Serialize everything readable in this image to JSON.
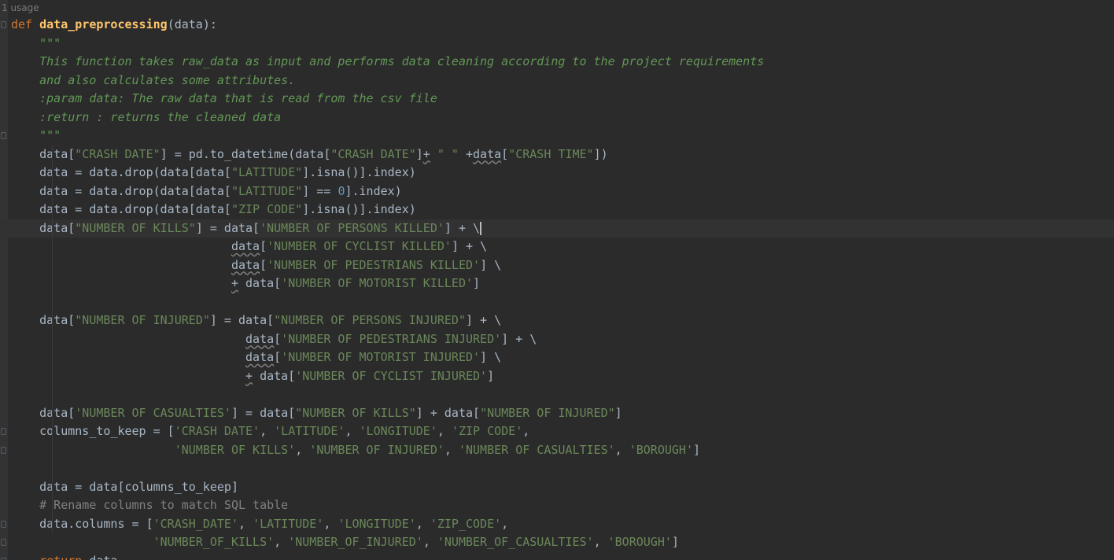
{
  "editor": {
    "usage_hint": "1 usage",
    "caret": {
      "line": 11
    },
    "lines": [
      [
        {
          "t": "def",
          "c": "kw"
        },
        {
          "t": " "
        },
        {
          "t": "data_preprocessing",
          "c": "fn"
        },
        {
          "t": "(data):"
        }
      ],
      [
        {
          "t": "    \"\"\"",
          "c": "doc"
        }
      ],
      [
        {
          "t": "    This function takes raw_data as input and performs data cleaning according to the project requirements",
          "c": "doc"
        }
      ],
      [
        {
          "t": "    and also calculates some attributes.",
          "c": "doc"
        }
      ],
      [
        {
          "t": "    :param data: The raw data that is read from the csv file",
          "c": "doc"
        }
      ],
      [
        {
          "t": "    :return : returns the cleaned data",
          "c": "doc"
        }
      ],
      [
        {
          "t": "    \"\"\"",
          "c": "doc"
        }
      ],
      [
        {
          "t": "    data["
        },
        {
          "t": "\"CRASH DATE\"",
          "c": "str"
        },
        {
          "t": "] = pd.to_datetime(data["
        },
        {
          "t": "\"CRASH DATE\"",
          "c": "str"
        },
        {
          "t": "]"
        },
        {
          "t": "+",
          "c": "wavy"
        },
        {
          "t": " "
        },
        {
          "t": "\" \"",
          "c": "str"
        },
        {
          "t": " +"
        },
        {
          "t": "data",
          "c": "wavy"
        },
        {
          "t": "["
        },
        {
          "t": "\"CRASH TIME\"",
          "c": "str"
        },
        {
          "t": "])"
        }
      ],
      [
        {
          "t": "    data = data.drop(data[data["
        },
        {
          "t": "\"LATITUDE\"",
          "c": "str"
        },
        {
          "t": "].isna()].index)"
        }
      ],
      [
        {
          "t": "    data = data.drop(data[data["
        },
        {
          "t": "\"LATITUDE\"",
          "c": "str"
        },
        {
          "t": "] == "
        },
        {
          "t": "0",
          "c": "num"
        },
        {
          "t": "].index)"
        }
      ],
      [
        {
          "t": "    data = data.drop(data[data["
        },
        {
          "t": "\"ZIP CODE\"",
          "c": "str"
        },
        {
          "t": "].isna()].index)"
        }
      ],
      [
        {
          "t": "    data["
        },
        {
          "t": "\"NUMBER OF KILLS\"",
          "c": "str"
        },
        {
          "t": "] = data["
        },
        {
          "t": "'NUMBER OF PERSONS KILLED'",
          "c": "str"
        },
        {
          "t": "] + \\"
        }
      ],
      [
        {
          "t": "                               "
        },
        {
          "t": "data",
          "c": "wavy"
        },
        {
          "t": "["
        },
        {
          "t": "'NUMBER OF CYCLIST KILLED'",
          "c": "str"
        },
        {
          "t": "] + \\"
        }
      ],
      [
        {
          "t": "                               "
        },
        {
          "t": "data",
          "c": "wavy"
        },
        {
          "t": "["
        },
        {
          "t": "'NUMBER OF PEDESTRIANS KILLED'",
          "c": "str"
        },
        {
          "t": "] \\"
        }
      ],
      [
        {
          "t": "                               "
        },
        {
          "t": "+",
          "c": "wavy"
        },
        {
          "t": " data["
        },
        {
          "t": "'NUMBER OF MOTORIST KILLED'",
          "c": "str"
        },
        {
          "t": "]"
        }
      ],
      [],
      [
        {
          "t": "    data["
        },
        {
          "t": "\"NUMBER OF INJURED\"",
          "c": "str"
        },
        {
          "t": "] = data["
        },
        {
          "t": "\"NUMBER OF PERSONS INJURED\"",
          "c": "str"
        },
        {
          "t": "] + \\"
        }
      ],
      [
        {
          "t": "                                 "
        },
        {
          "t": "data",
          "c": "wavy"
        },
        {
          "t": "["
        },
        {
          "t": "'NUMBER OF PEDESTRIANS INJURED'",
          "c": "str"
        },
        {
          "t": "] + \\"
        }
      ],
      [
        {
          "t": "                                 "
        },
        {
          "t": "data",
          "c": "wavy"
        },
        {
          "t": "["
        },
        {
          "t": "'NUMBER OF MOTORIST INJURED'",
          "c": "str"
        },
        {
          "t": "] \\"
        }
      ],
      [
        {
          "t": "                                 "
        },
        {
          "t": "+",
          "c": "wavy"
        },
        {
          "t": " data["
        },
        {
          "t": "'NUMBER OF CYCLIST INJURED'",
          "c": "str"
        },
        {
          "t": "]"
        }
      ],
      [],
      [
        {
          "t": "    data["
        },
        {
          "t": "'NUMBER OF CASUALTIES'",
          "c": "str"
        },
        {
          "t": "] = data["
        },
        {
          "t": "\"NUMBER OF KILLS\"",
          "c": "str"
        },
        {
          "t": "] + data["
        },
        {
          "t": "\"NUMBER OF INJURED\"",
          "c": "str"
        },
        {
          "t": "]"
        }
      ],
      [
        {
          "t": "    columns_to_keep = ["
        },
        {
          "t": "'CRASH DATE'",
          "c": "str"
        },
        {
          "t": ", "
        },
        {
          "t": "'LATITUDE'",
          "c": "str"
        },
        {
          "t": ", "
        },
        {
          "t": "'LONGITUDE'",
          "c": "str"
        },
        {
          "t": ", "
        },
        {
          "t": "'ZIP CODE'",
          "c": "str"
        },
        {
          "t": ","
        }
      ],
      [
        {
          "t": "                       "
        },
        {
          "t": "'NUMBER OF KILLS'",
          "c": "str"
        },
        {
          "t": ", "
        },
        {
          "t": "'NUMBER OF INJURED'",
          "c": "str"
        },
        {
          "t": ", "
        },
        {
          "t": "'NUMBER OF CASUALTIES'",
          "c": "str"
        },
        {
          "t": ", "
        },
        {
          "t": "'BOROUGH'",
          "c": "str"
        },
        {
          "t": "]"
        }
      ],
      [],
      [
        {
          "t": "    data = data[columns_to_keep]"
        }
      ],
      [
        {
          "t": "    # Rename columns to match SQL table",
          "c": "cmt"
        }
      ],
      [
        {
          "t": "    data.columns = ["
        },
        {
          "t": "'CRASH_DATE'",
          "c": "str"
        },
        {
          "t": ", "
        },
        {
          "t": "'LATITUDE'",
          "c": "str"
        },
        {
          "t": ", "
        },
        {
          "t": "'LONGITUDE'",
          "c": "str"
        },
        {
          "t": ", "
        },
        {
          "t": "'ZIP_CODE'",
          "c": "str"
        },
        {
          "t": ","
        }
      ],
      [
        {
          "t": "                    "
        },
        {
          "t": "'NUMBER_OF_KILLS'",
          "c": "str"
        },
        {
          "t": ", "
        },
        {
          "t": "'NUMBER_OF_INJURED'",
          "c": "str"
        },
        {
          "t": ", "
        },
        {
          "t": "'NUMBER_OF_CASUALTIES'",
          "c": "str"
        },
        {
          "t": ", "
        },
        {
          "t": "'BOROUGH'",
          "c": "str"
        },
        {
          "t": "]"
        }
      ],
      [
        {
          "t": "    "
        },
        {
          "t": "return",
          "c": "kw"
        },
        {
          "t": " data"
        }
      ]
    ]
  }
}
